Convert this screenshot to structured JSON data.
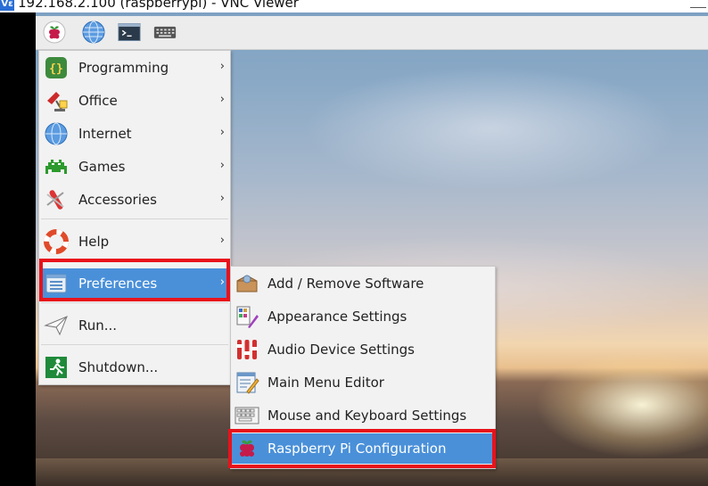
{
  "window": {
    "title": "192.168.2.100 (raspberrypi) - VNC Viewer",
    "app_badge": "Vε"
  },
  "taskbar": {
    "icons": [
      "raspberry-menu-icon",
      "web-browser-icon",
      "terminal-icon",
      "keyboard-icon"
    ]
  },
  "main_menu": {
    "items": [
      {
        "label": "Programming",
        "icon": "programming-icon",
        "submenu": true
      },
      {
        "label": "Office",
        "icon": "office-icon",
        "submenu": true
      },
      {
        "label": "Internet",
        "icon": "internet-icon",
        "submenu": true
      },
      {
        "label": "Games",
        "icon": "games-icon",
        "submenu": true
      },
      {
        "label": "Accessories",
        "icon": "accessories-icon",
        "submenu": true
      },
      {
        "label": "Help",
        "icon": "help-icon",
        "submenu": true
      },
      {
        "label": "Preferences",
        "icon": "preferences-icon",
        "submenu": true,
        "selected": true
      },
      {
        "label": "Run...",
        "icon": "run-icon",
        "submenu": false
      },
      {
        "label": "Shutdown...",
        "icon": "shutdown-icon",
        "submenu": false
      }
    ],
    "arrow_glyph": "›"
  },
  "preferences_menu": {
    "items": [
      {
        "label": "Add / Remove Software",
        "icon": "package-icon"
      },
      {
        "label": "Appearance Settings",
        "icon": "appearance-icon"
      },
      {
        "label": "Audio Device Settings",
        "icon": "audio-mixer-icon"
      },
      {
        "label": "Main Menu Editor",
        "icon": "menu-editor-icon"
      },
      {
        "label": "Mouse and Keyboard Settings",
        "icon": "keyboard-mouse-icon"
      },
      {
        "label": "Raspberry Pi Configuration",
        "icon": "raspberry-config-icon",
        "selected": true
      }
    ]
  },
  "colors": {
    "highlight": "#4a90d9",
    "annotation": "#e8121b",
    "menu_bg": "#f2f2f2"
  }
}
